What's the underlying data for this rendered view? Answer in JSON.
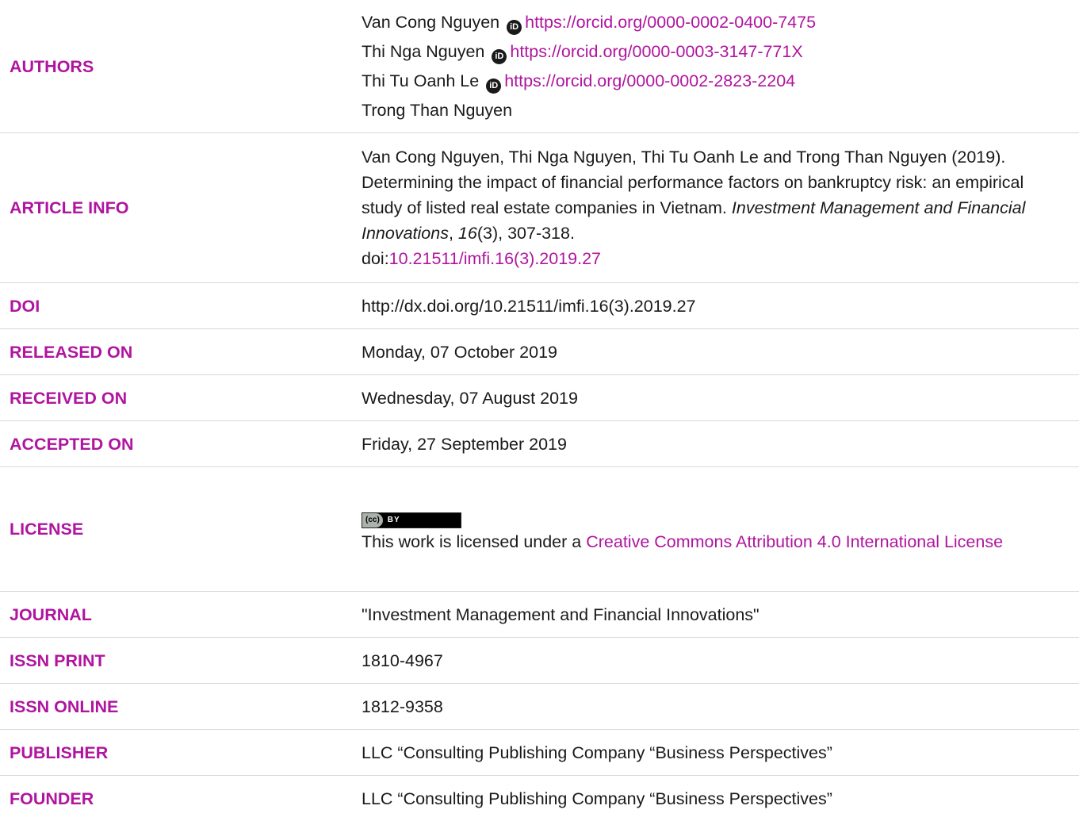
{
  "rows": {
    "authors": {
      "label": "AUTHORS",
      "items": [
        {
          "name": "Van Cong Nguyen",
          "orcid": "https://orcid.org/0000-0002-0400-7475"
        },
        {
          "name": "Thi Nga Nguyen",
          "orcid": "https://orcid.org/0000-0003-3147-771X"
        },
        {
          "name": "Thi Tu Oanh Le",
          "orcid": "https://orcid.org/0000-0002-2823-2204"
        },
        {
          "name": "Trong Than Nguyen",
          "orcid": ""
        }
      ],
      "orcid_icon_text": "iD"
    },
    "article_info": {
      "label": "ARTICLE INFO",
      "citation_prefix": "Van Cong Nguyen, Thi Nga Nguyen, Thi Tu Oanh Le and Trong Than Nguyen (2019). Determining the impact of financial performance factors on bankruptcy risk: an empirical study of listed real estate companies in Vietnam. ",
      "journal_italic": "Investment Management and Financial Innovations",
      "sep1": ", ",
      "volume_italic": "16",
      "issue_pages": "(3), 307-318.",
      "doi_prefix": "doi:",
      "doi_link": "10.21511/imfi.16(3).2019.27"
    },
    "doi": {
      "label": "DOI",
      "value": "http://dx.doi.org/10.21511/imfi.16(3).2019.27"
    },
    "released_on": {
      "label": "RELEASED ON",
      "value": "Monday, 07 October 2019"
    },
    "received_on": {
      "label": "RECEIVED ON",
      "value": "Wednesday, 07 August 2019"
    },
    "accepted_on": {
      "label": "ACCEPTED ON",
      "value": "Friday, 27 September 2019"
    },
    "license": {
      "label": "LICENSE",
      "badge_cc": "(cc)",
      "badge_by": "BY",
      "text": "This work is licensed under a ",
      "link": "Creative Commons Attribution 4.0 International License"
    },
    "journal": {
      "label": "JOURNAL",
      "value": "\"Investment Management and Financial Innovations\""
    },
    "issn_print": {
      "label": "ISSN PRINT",
      "value": "1810-4967"
    },
    "issn_online": {
      "label": "ISSN ONLINE",
      "value": "1812-9358"
    },
    "publisher": {
      "label": "PUBLISHER",
      "value": "LLC “Consulting Publishing Company “Business Perspectives”"
    },
    "founder": {
      "label": "FOUNDER",
      "value": "LLC “Consulting Publishing Company “Business Perspectives”"
    }
  }
}
